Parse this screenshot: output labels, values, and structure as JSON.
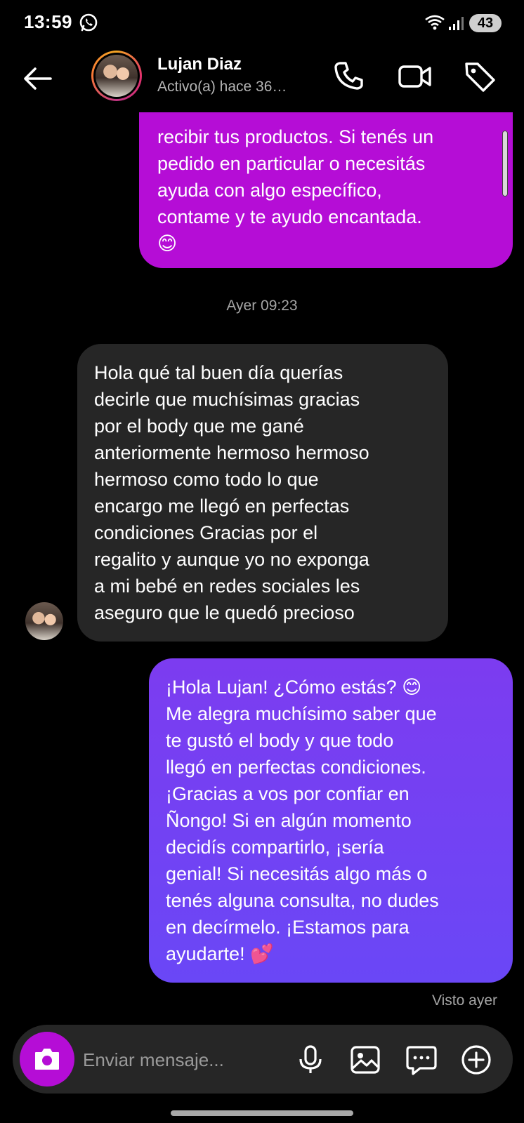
{
  "status_bar": {
    "time": "13:59",
    "battery": "43",
    "icons": [
      "whatsapp-icon",
      "wifi-icon",
      "signal-icon"
    ]
  },
  "header": {
    "contact_name": "Lujan Diaz",
    "contact_status": "Activo(a) hace 36…",
    "icons": [
      "back-arrow-icon",
      "phone-icon",
      "video-camera-icon",
      "tag-icon"
    ]
  },
  "messages": [
    {
      "direction": "outgoing",
      "text": "recibir tus productos. Si tenés un\npedido en particular o necesitás\nayuda con algo específico,\ncontame y te ayudo encantada.\n😊"
    },
    {
      "type": "separator",
      "text": "Ayer 09:23"
    },
    {
      "direction": "incoming",
      "text": "Hola qué tal buen día querías\ndecirle que muchísimas gracias\npor el body que me gané\nanteriormente hermoso hermoso\nhermoso como todo lo que\nencargo me llegó en perfectas\ncondiciones Gracias por el\nregalito y aunque yo no exponga\na mi bebé en redes sociales les\naseguro que le quedó precioso"
    },
    {
      "direction": "outgoing",
      "text": "¡Hola Lujan! ¿Cómo estás? 😊\nMe alegra muchísimo saber que\nte gustó el body y que todo\nllegó en perfectas condiciones.\n¡Gracias a vos por confiar en\nÑongo! Si en algún momento\ndecidís compartirlo, ¡sería\ngenial! Si necesitás algo más o\ntenés alguna consulta, no dudes\nen decírmelo. ¡Estamos para\nayudarte! 💕"
    }
  ],
  "seen_status": "Visto ayer",
  "composer": {
    "placeholder": "Enviar mensaje...",
    "icons": [
      "camera-icon",
      "microphone-icon",
      "gallery-icon",
      "sticker-icon",
      "plus-icon"
    ]
  },
  "colors": {
    "outgoing_magenta": "#b50dd6",
    "outgoing_purple": "#6a47f6",
    "incoming_gray": "#262626",
    "background": "#000000"
  }
}
